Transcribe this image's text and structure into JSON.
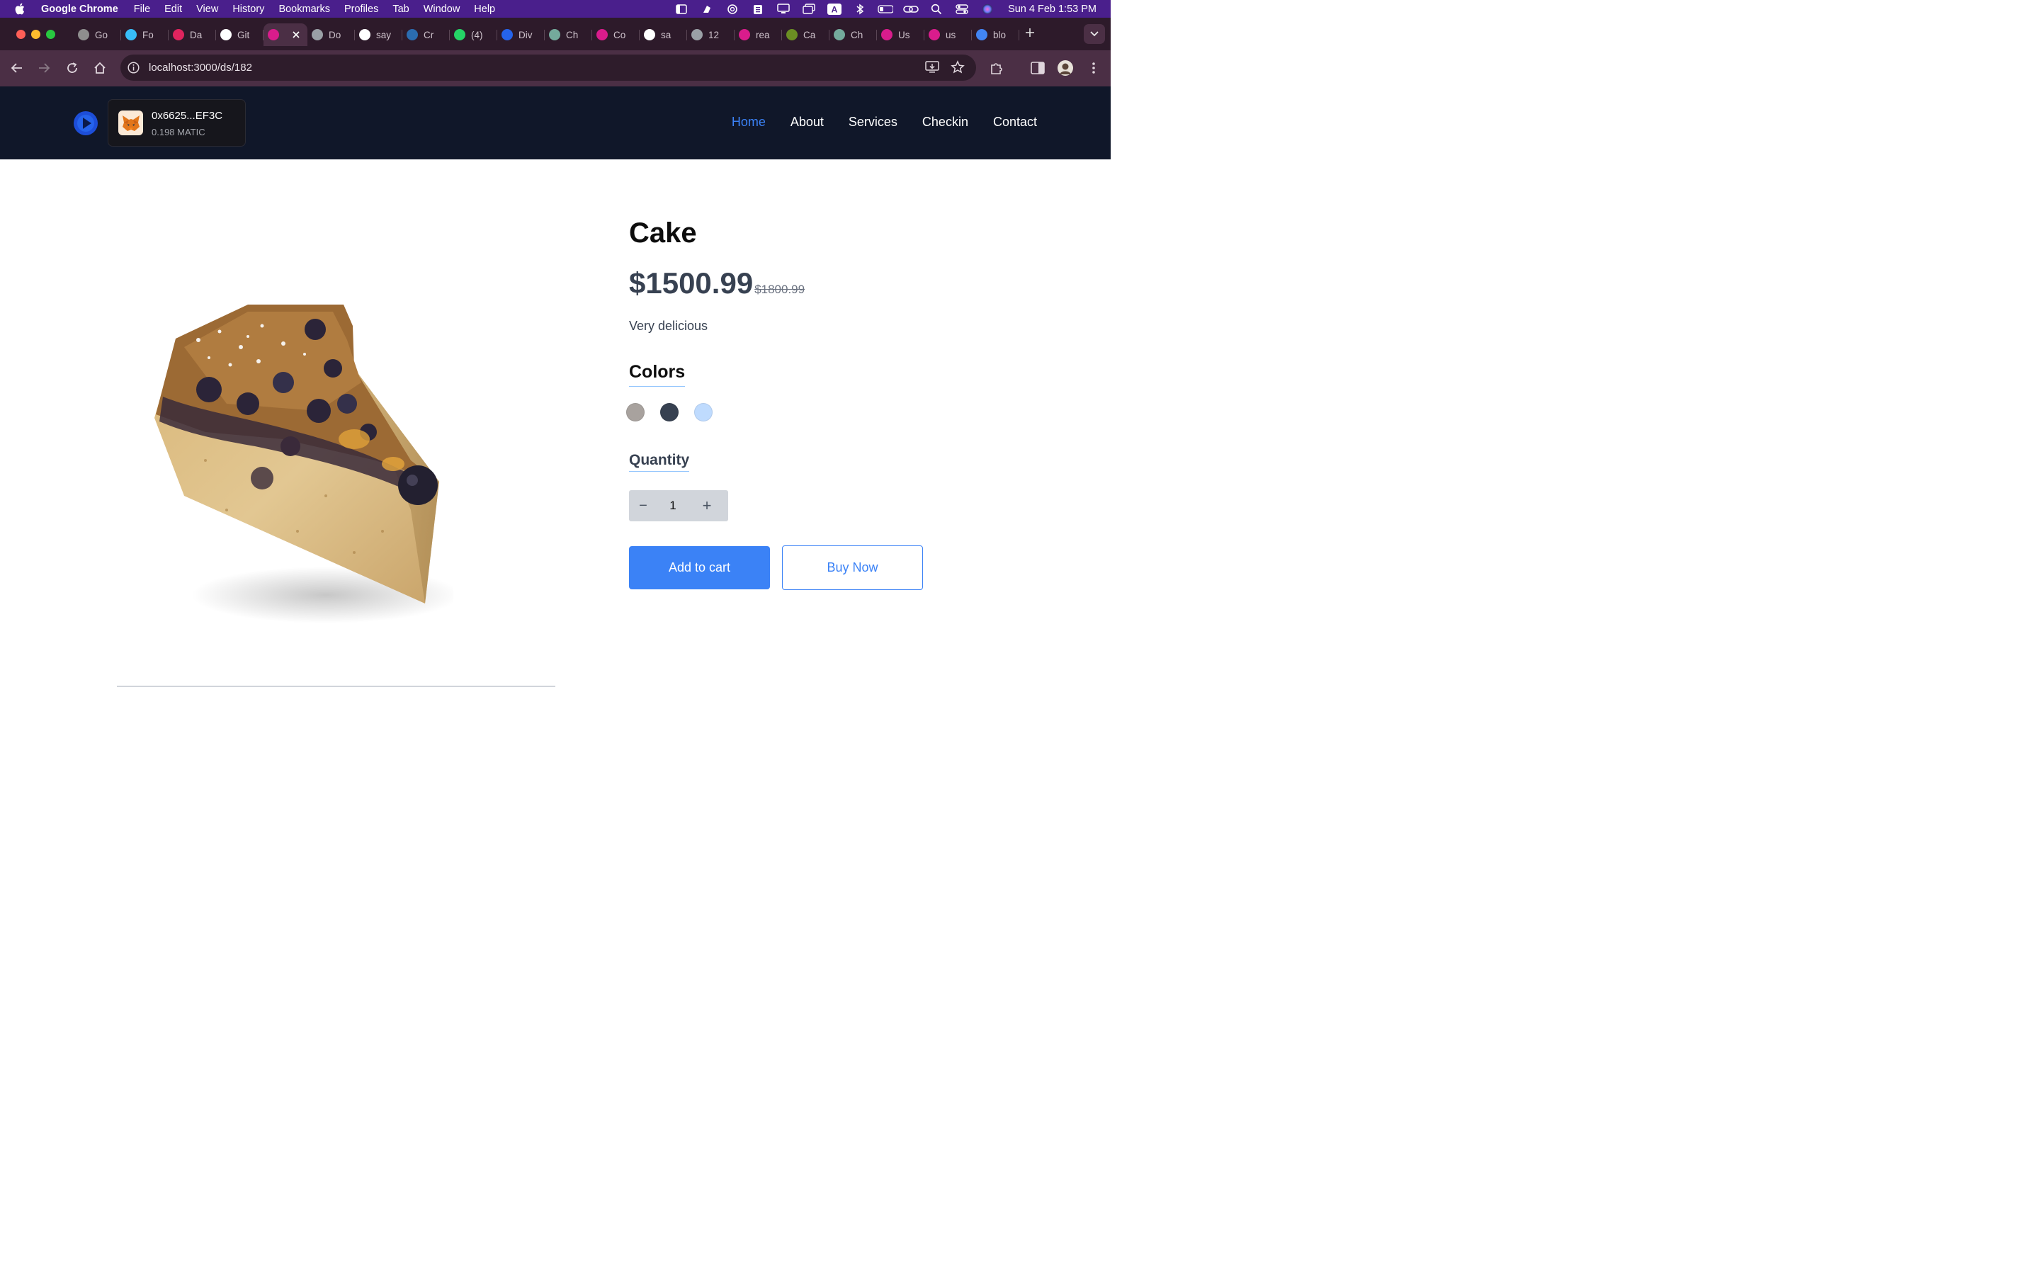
{
  "os_menu": {
    "app_name": "Google Chrome",
    "items": [
      "File",
      "Edit",
      "View",
      "History",
      "Bookmarks",
      "Profiles",
      "Tab",
      "Window",
      "Help"
    ],
    "clock": "Sun 4 Feb  1:53 PM",
    "status_icons": [
      "sidebar-icon",
      "app-icon",
      "sync-icon",
      "clipboard-icon",
      "display-icon",
      "window-icon",
      "keyboard-a-icon",
      "bluetooth-icon",
      "battery-icon",
      "link-icon",
      "search-icon",
      "control-center-icon",
      "siri-icon"
    ]
  },
  "browser": {
    "tabs": [
      {
        "title": "Go",
        "icon": "google-icon",
        "color": "#8e8e8e"
      },
      {
        "title": "Fo",
        "icon": "tailwind-icon",
        "color": "#38bdf8"
      },
      {
        "title": "Da",
        "icon": "dash-icon",
        "color": "#e0245e"
      },
      {
        "title": "Git",
        "icon": "github-icon",
        "color": "#ffffff"
      },
      {
        "title": "",
        "icon": "webflow-icon",
        "color": "#d91c8c",
        "active": true
      },
      {
        "title": "Do",
        "icon": "globe-icon",
        "color": "#9aa0a6"
      },
      {
        "title": "say",
        "icon": "github-icon",
        "color": "#ffffff"
      },
      {
        "title": "Cr",
        "icon": "bird-icon",
        "color": "#2b6cb0"
      },
      {
        "title": "(4)",
        "icon": "whatsapp-icon",
        "color": "#25d366"
      },
      {
        "title": "Div",
        "icon": "doc-icon",
        "color": "#2563eb"
      },
      {
        "title": "Ch",
        "icon": "chatgpt-icon",
        "color": "#74aa9c"
      },
      {
        "title": "Co",
        "icon": "webflow-icon",
        "color": "#d91c8c"
      },
      {
        "title": "sa",
        "icon": "github-icon",
        "color": "#ffffff"
      },
      {
        "title": "12",
        "icon": "globe-icon",
        "color": "#9aa0a6"
      },
      {
        "title": "rea",
        "icon": "webflow-icon",
        "color": "#d91c8c"
      },
      {
        "title": "Ca",
        "icon": "tool-icon",
        "color": "#6b8e23"
      },
      {
        "title": "Ch",
        "icon": "chatgpt-icon",
        "color": "#74aa9c"
      },
      {
        "title": "Us",
        "icon": "webflow-icon",
        "color": "#d91c8c"
      },
      {
        "title": "us",
        "icon": "webflow-icon",
        "color": "#d91c8c"
      },
      {
        "title": "blo",
        "icon": "google-icon",
        "color": "#4285f4"
      }
    ],
    "url": "localhost:3000/ds/182"
  },
  "site": {
    "wallet": {
      "address": "0x6625...EF3C",
      "balance": "0.198 MATIC"
    },
    "nav": [
      {
        "label": "Home",
        "active": true
      },
      {
        "label": "About",
        "active": false
      },
      {
        "label": "Services",
        "active": false
      },
      {
        "label": "Checkin",
        "active": false
      },
      {
        "label": "Contact",
        "active": false
      }
    ]
  },
  "product": {
    "title": "Cake",
    "price": "$1500.99",
    "old_price": "$1800.99",
    "description": "Very delicious",
    "colors_label": "Colors",
    "colors": [
      "#a8a29e",
      "#374151",
      "#bfdbfe"
    ],
    "quantity_label": "Quantity",
    "quantity": "1",
    "minus_symbol": "−",
    "plus_symbol": "+",
    "add_to_cart_label": "Add to cart",
    "buy_now_label": "Buy Now"
  },
  "colors": {
    "menubar": "#4a1f8c",
    "tabstrip": "#2d1a2a",
    "toolbar": "#4b2f45",
    "navbar": "#101729",
    "accent": "#3b82f6"
  }
}
